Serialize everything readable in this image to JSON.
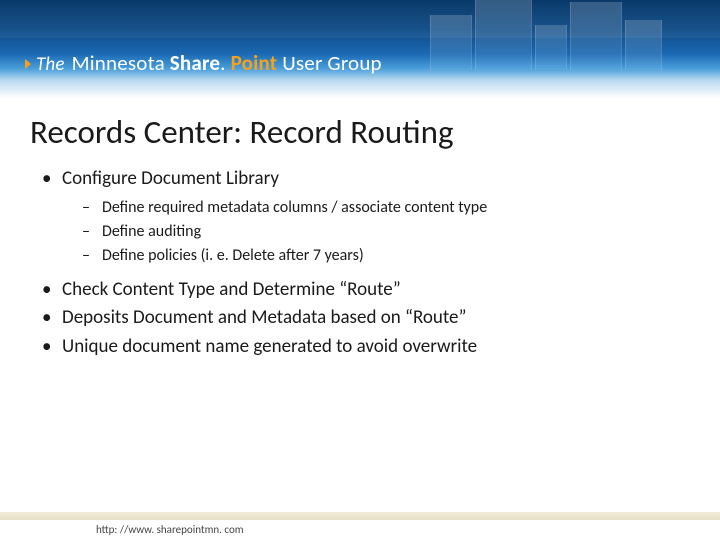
{
  "banner": {
    "the": "The",
    "minnesota": "Minnesota",
    "share": "Share",
    "point": "Point",
    "usergroup": "User Group"
  },
  "title": "Records Center: Record Routing",
  "bullets": {
    "b1": "Configure Document Library",
    "b1_subs": {
      "s1": "Define required metadata columns / associate content type",
      "s2": "Define auditing",
      "s3": "Define policies (i. e. Delete after 7 years)"
    },
    "b2": "Check Content Type and Determine “Route”",
    "b3": "Deposits Document and Metadata based on “Route”",
    "b4": "Unique document name generated to avoid overwrite"
  },
  "footer": {
    "url": "http: //www. sharepointmn. com"
  }
}
